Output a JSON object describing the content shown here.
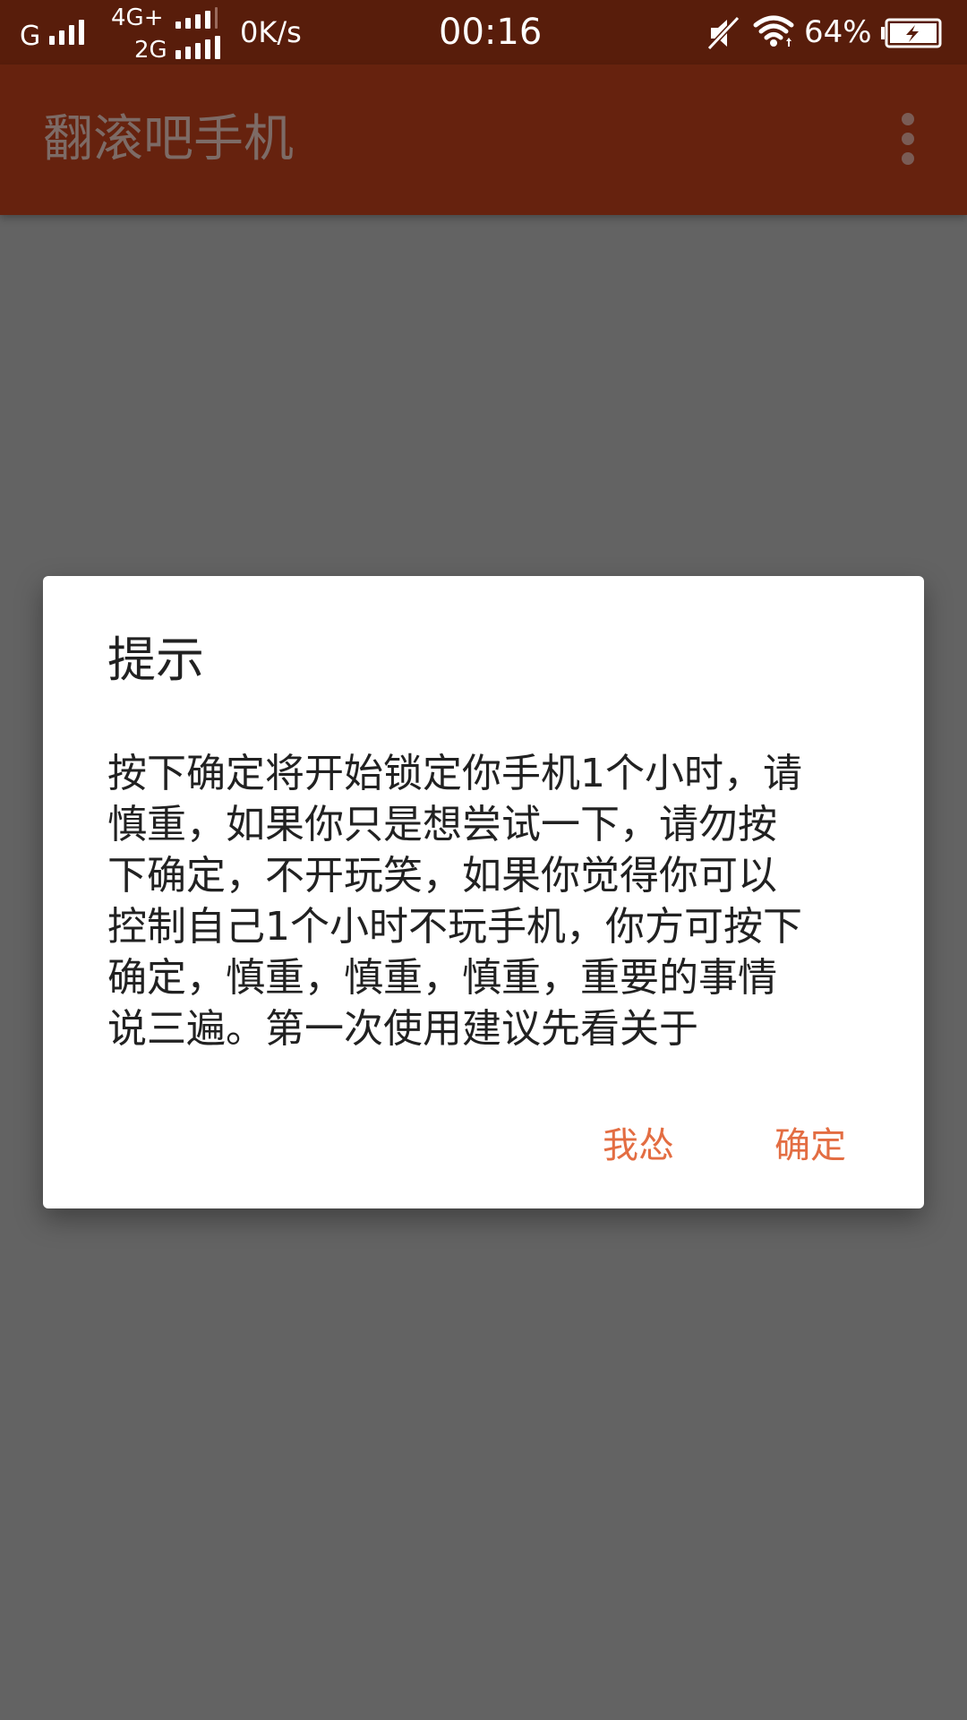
{
  "status_bar": {
    "carrier1": "G",
    "network_top": "4G+",
    "network_bottom": "2G",
    "speed": "0K/s",
    "time": "00:16",
    "battery": "64%",
    "icons": [
      "signal-icon",
      "mute-icon",
      "wifi-icon",
      "battery-charging-icon"
    ]
  },
  "app_bar": {
    "title": "翻滚吧手机",
    "menu_icon": "more-vert-icon"
  },
  "dialog": {
    "title": "提示",
    "message": "按下确定将开始锁定你手机1个小时，请慎重，如果你只是想尝试一下，请勿按下确定，不开玩笑，如果你觉得你可以控制自己1个小时不玩手机，你方可按下确定，慎重，慎重，慎重，重要的事情说三遍。第一次使用建议先看关于",
    "cancel_label": "我怂",
    "ok_label": "确定"
  },
  "colors": {
    "status_bar": "#581d0b",
    "app_bar": "#66220e",
    "scrim": "#636363",
    "accent": "#e36d42"
  }
}
